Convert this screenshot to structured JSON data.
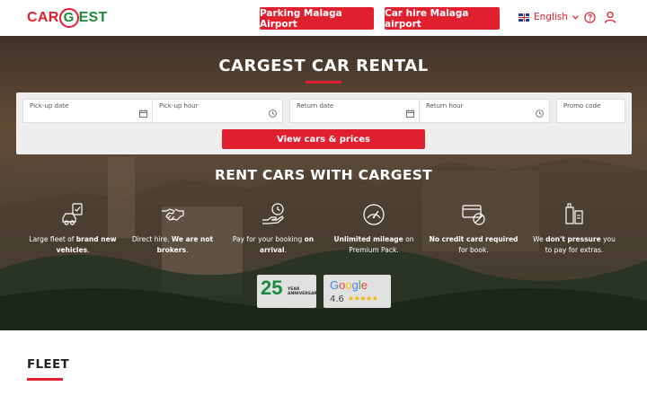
{
  "header": {
    "logo": {
      "car": "CAR",
      "g": "G",
      "est": "EST"
    },
    "parking_button": "Parking Malaga Airport",
    "carhire_button": "Car hire Malaga airport",
    "language": "English",
    "help_icon": "help-circle-icon",
    "user_icon": "user-icon"
  },
  "hero": {
    "title": "CARGEST CAR RENTAL",
    "search": {
      "pickup_date_label": "Pick-up date",
      "pickup_hour_label": "Pick-up hour",
      "return_date_label": "Return date",
      "return_hour_label": "Return hour",
      "promo_label": "Promo code",
      "submit_label": "View cars & prices"
    },
    "rent_title": "RENT CARS WITH CARGEST",
    "features": [
      {
        "icon": "car-check-icon",
        "pre": "Large fleet of",
        "bold": "brand new vehicles",
        "post": "."
      },
      {
        "icon": "handshake-icon",
        "pre": "Direct hire.",
        "bold": "We are not brokers",
        "post": "."
      },
      {
        "icon": "pay-on-arrival-icon",
        "pre": "Pay for your booking",
        "bold": "on arrival",
        "post": "."
      },
      {
        "icon": "speedometer-icon",
        "pre": "",
        "bold": "Unlimited mileage",
        "post": "on Premium Pack."
      },
      {
        "icon": "no-credit-card-icon",
        "pre": "",
        "bold": "No credit card required",
        "post": "for book."
      },
      {
        "icon": "no-pressure-icon",
        "pre": "We",
        "bold": "don't pressure",
        "post": "you to pay for extras."
      }
    ],
    "badges": {
      "anniversary_number": "25",
      "anniversary_text": "YEAR ANNIVERSARY",
      "google_word": "Google",
      "google_rating": "4.6",
      "google_stars": "★★★★★"
    }
  },
  "fleet": {
    "title": "FLEET"
  },
  "colors": {
    "accent": "#e0202f",
    "brand_green": "#1b8a3a"
  }
}
